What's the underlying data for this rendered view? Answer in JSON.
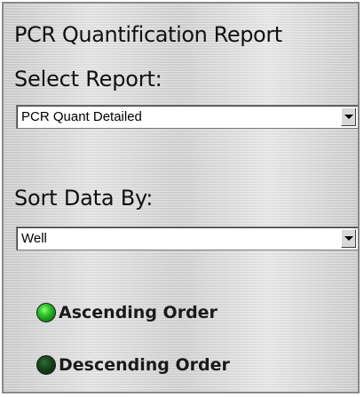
{
  "panel": {
    "title": "PCR Quantification Report"
  },
  "select_report": {
    "label": "Select Report:",
    "value": "PCR Quant Detailed"
  },
  "sort_data_by": {
    "label": "Sort Data By:",
    "value": "Well"
  },
  "order": {
    "ascending_label": "Ascending Order",
    "descending_label": "Descending Order",
    "selected": "ascending"
  },
  "colors": {
    "radio_on": "#2fc42a",
    "radio_off": "#143d19"
  }
}
